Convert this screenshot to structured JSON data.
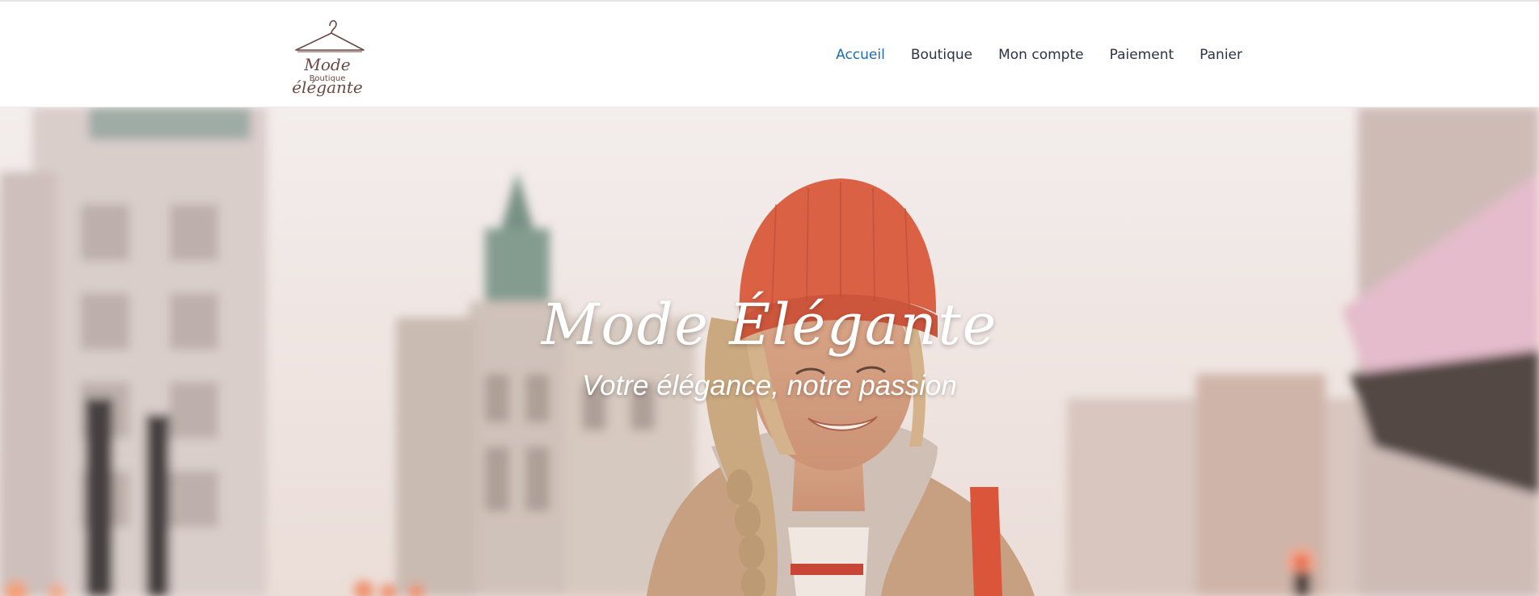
{
  "header": {
    "logo": {
      "icon": "clothes-hanger-icon",
      "line1": "Mode",
      "line2": "Boutique",
      "line3": "élégante"
    },
    "nav": [
      {
        "label": "Accueil",
        "active": true
      },
      {
        "label": "Boutique",
        "active": false
      },
      {
        "label": "Mon compte",
        "active": false
      },
      {
        "label": "Paiement",
        "active": false
      },
      {
        "label": "Panier",
        "active": false
      }
    ]
  },
  "hero": {
    "title": "Mode Élégante",
    "subtitle": "Votre élégance, notre passion",
    "image": "woman-in-orange-beanie-city-street-photo"
  },
  "colors": {
    "nav_text": "#2c3345",
    "nav_active": "#1e6bb0",
    "logo": "#6b4a44",
    "hero_text": "#ffffff"
  }
}
